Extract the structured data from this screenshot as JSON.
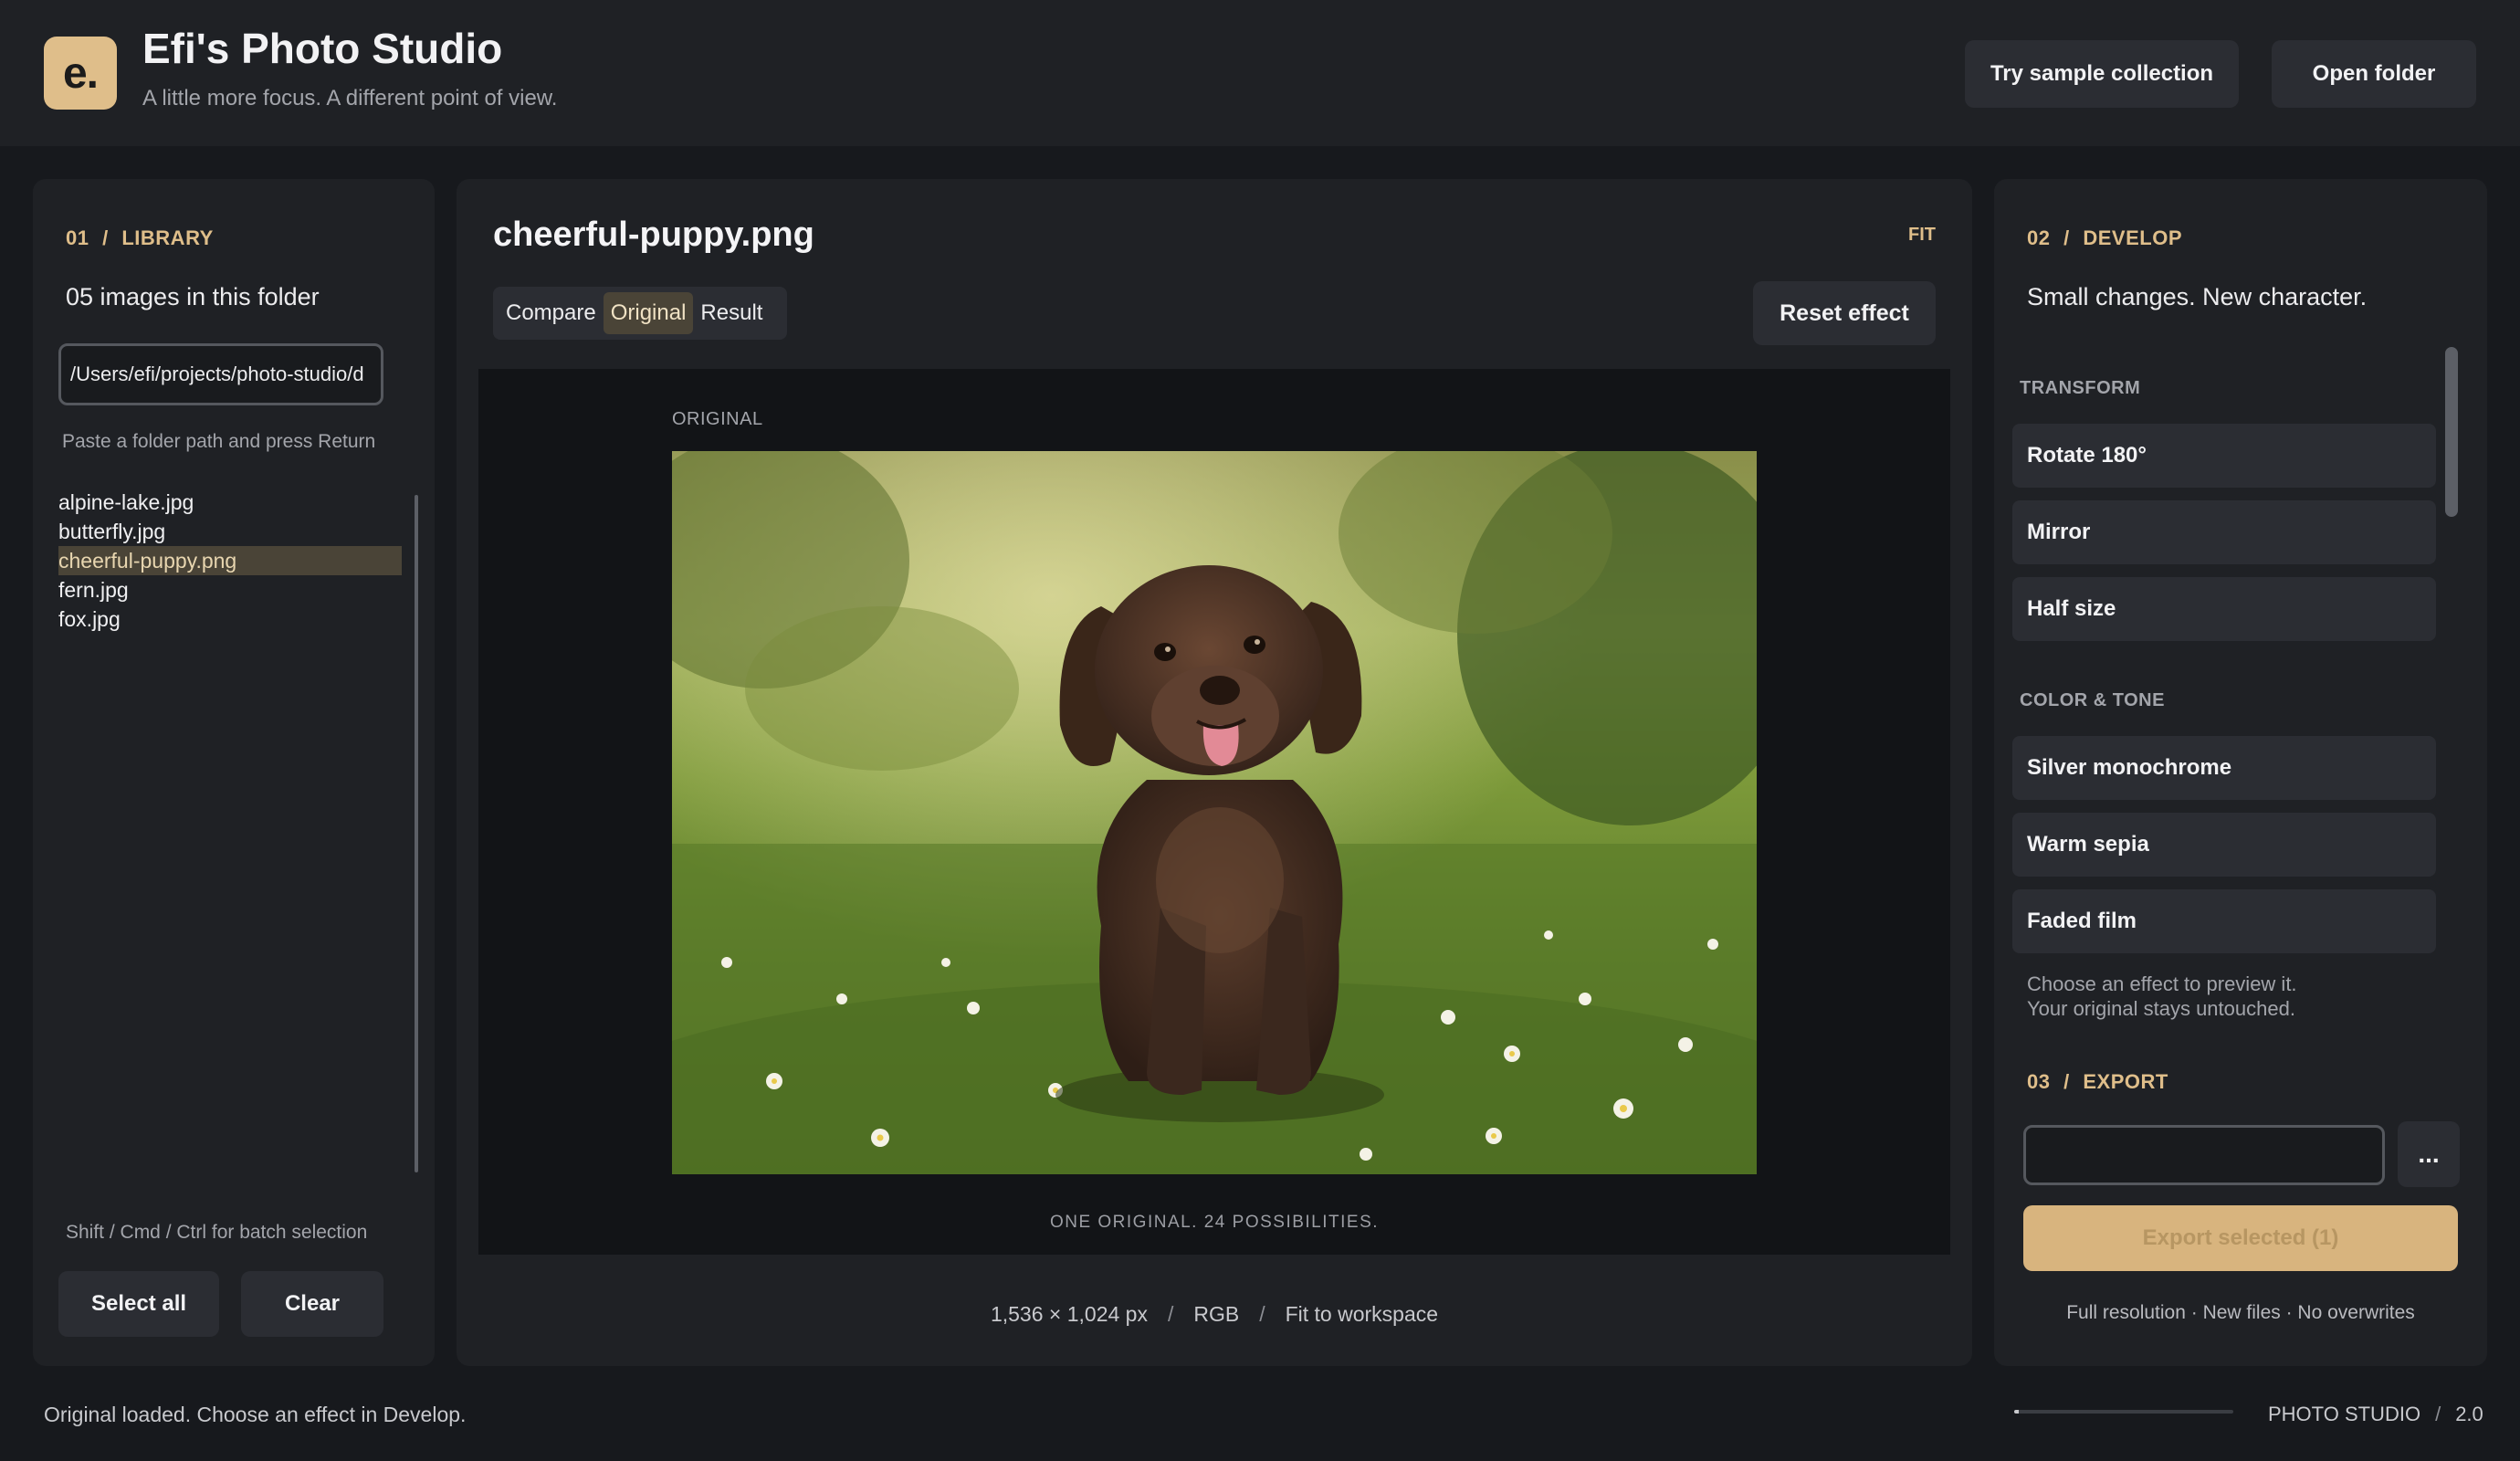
{
  "app": {
    "logo_text": "e.",
    "title": "Efi's Photo Studio",
    "subtitle": "A little more focus. A different point of view.",
    "buttons": {
      "sample": "Try sample collection",
      "open_folder": "Open folder"
    }
  },
  "library": {
    "section_num": "01",
    "section_label": "LIBRARY",
    "count_text": "05 images in this folder",
    "path_value": "/Users/efi/projects/photo-studio/d",
    "path_hint": "Paste a folder path and press Return",
    "files": [
      {
        "name": "alpine-lake.jpg",
        "selected": false
      },
      {
        "name": "butterfly.jpg",
        "selected": false
      },
      {
        "name": "cheerful-puppy.png",
        "selected": true
      },
      {
        "name": "fern.jpg",
        "selected": false
      },
      {
        "name": "fox.jpg",
        "selected": false
      }
    ],
    "batch_hint": "Shift / Cmd / Ctrl for batch selection",
    "select_all": "Select all",
    "clear": "Clear"
  },
  "viewer": {
    "file_title": "cheerful-puppy.png",
    "fit_label": "FIT",
    "tabs": [
      {
        "label": "Compare",
        "active": false
      },
      {
        "label": "Original",
        "active": true
      },
      {
        "label": "Result",
        "active": false
      }
    ],
    "reset": "Reset effect",
    "workspace_label": "ORIGINAL",
    "tagline": "ONE ORIGINAL. 24 POSSIBILITIES.",
    "meta": {
      "dimensions": "1,536 × 1,024 px",
      "color_mode": "RGB",
      "fit_mode": "Fit to workspace",
      "separator": "/"
    }
  },
  "develop": {
    "section_num": "02",
    "section_label": "DEVELOP",
    "subtitle": "Small changes. New character.",
    "groups": {
      "transform": {
        "label": "TRANSFORM",
        "items": [
          "Rotate 180°",
          "Mirror",
          "Half size"
        ]
      },
      "color_tone": {
        "label": "COLOR & TONE",
        "items": [
          "Silver monochrome",
          "Warm sepia",
          "Faded film"
        ]
      }
    },
    "hint_line1": "Choose an effect to preview it.",
    "hint_line2": "Your original stays untouched."
  },
  "export": {
    "section_num": "03",
    "section_label": "EXPORT",
    "input_value": "",
    "more_button": "...",
    "export_button": "Export selected (1)",
    "note": "Full resolution · New files · No overwrites"
  },
  "status": {
    "message": "Original loaded. Choose an effect in Develop.",
    "progress": 0.02,
    "product": "PHOTO STUDIO",
    "separator": "/",
    "version": "2.0"
  },
  "colors": {
    "accent": "#dfbe8a",
    "background": "#17191d",
    "panel": "#1f2125",
    "button": "#2b2d33",
    "selected": "#4a4437"
  }
}
